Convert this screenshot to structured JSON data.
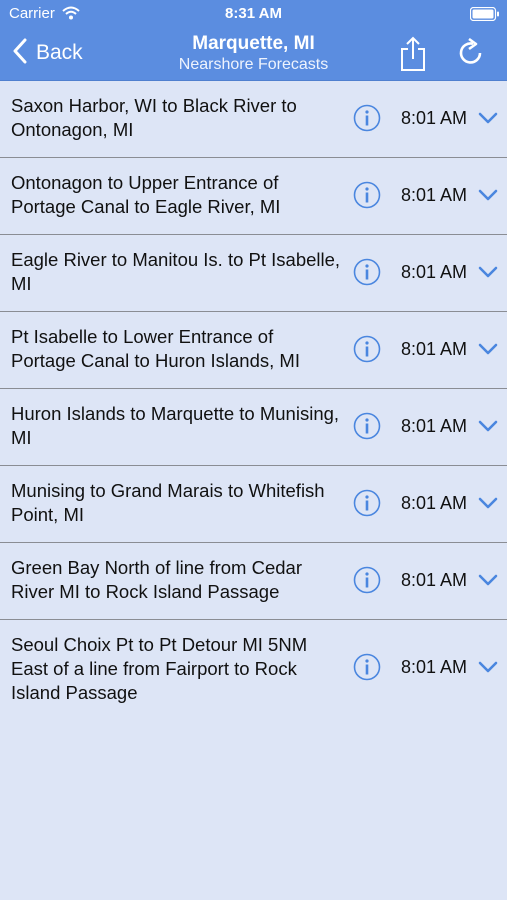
{
  "status_bar": {
    "carrier": "Carrier",
    "time": "8:31 AM"
  },
  "nav": {
    "back_label": "Back",
    "title": "Marquette, MI",
    "subtitle": "Nearshore Forecasts"
  },
  "colors": {
    "accent": "#5b8de0",
    "background": "#dde5f6",
    "icon": "#4a86df"
  },
  "forecasts": [
    {
      "title": "Saxon Harbor, WI to Black River to Ontonagon, MI",
      "time": "8:01 AM"
    },
    {
      "title": "Ontonagon to Upper Entrance of Portage Canal to Eagle River, MI",
      "time": "8:01 AM"
    },
    {
      "title": "Eagle River to Manitou Is. to Pt Isabelle, MI",
      "time": "8:01 AM"
    },
    {
      "title": "Pt Isabelle to Lower Entrance of Portage Canal to Huron Islands, MI",
      "time": "8:01 AM"
    },
    {
      "title": "Huron Islands to Marquette to Munising, MI",
      "time": "8:01 AM"
    },
    {
      "title": "Munising to Grand Marais to Whitefish Point, MI",
      "time": "8:01 AM"
    },
    {
      "title": "Green Bay North of line from Cedar River MI to Rock Island Passage",
      "time": "8:01 AM"
    },
    {
      "title": "Seoul Choix Pt to Pt Detour MI 5NM East of a line from Fairport to Rock Island Passage",
      "time": "8:01 AM"
    }
  ]
}
